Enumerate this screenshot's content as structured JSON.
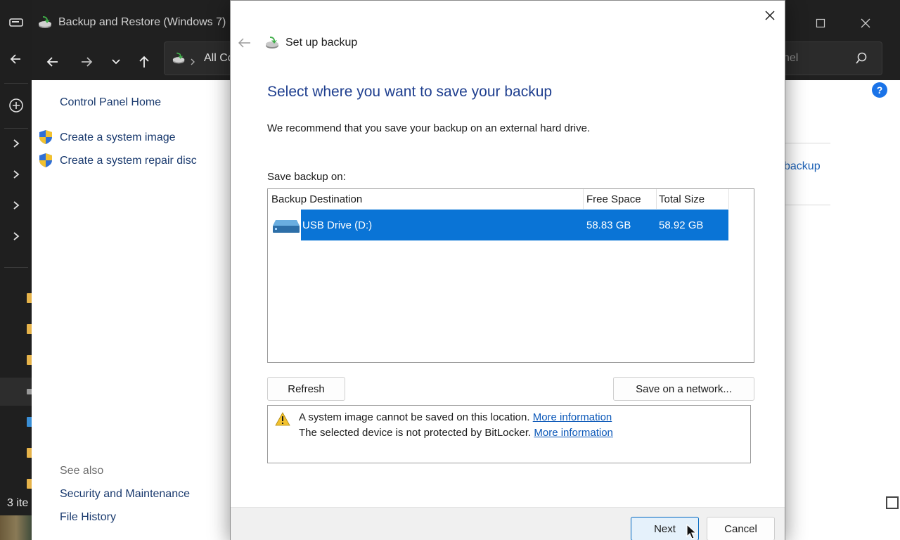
{
  "explorer": {
    "items_count": "3 ite"
  },
  "window": {
    "title": "Backup and Restore (Windows 7)",
    "address_text": "All Co",
    "search_placeholder": "nel"
  },
  "control_panel": {
    "home_link": "Control Panel Home",
    "tasks": [
      {
        "label": "Create a system image",
        "icon": "shield-icon"
      },
      {
        "label": "Create a system repair disc",
        "icon": "shield-icon"
      }
    ],
    "see_also_label": "See also",
    "see_also": [
      "Security and Maintenance",
      "File History"
    ],
    "right_link": "backup"
  },
  "dialog": {
    "title": "Set up backup",
    "heading": "Select where you want to save your backup",
    "description": "We recommend that you save your backup on an external hard drive.",
    "save_on_label": "Save backup on:",
    "columns": {
      "destination": "Backup Destination",
      "free": "Free Space",
      "total": "Total Size"
    },
    "rows": [
      {
        "destination": "USB Drive (D:)",
        "free": "58.83 GB",
        "total": "58.92 GB",
        "selected": true,
        "icon": "usb-drive-icon"
      }
    ],
    "refresh_button": "Refresh",
    "network_button": "Save on a network...",
    "warnings": [
      {
        "text": "A system image cannot be saved on this location.",
        "link": "More information"
      },
      {
        "text": "The selected device is not protected by BitLocker.",
        "link": "More information"
      }
    ],
    "next_button": "Next",
    "cancel_button": "Cancel"
  },
  "colors": {
    "selection": "#0a74d6",
    "heading": "#1f3f8f",
    "link": "#0a57b8",
    "dark_chrome": "#202020"
  }
}
